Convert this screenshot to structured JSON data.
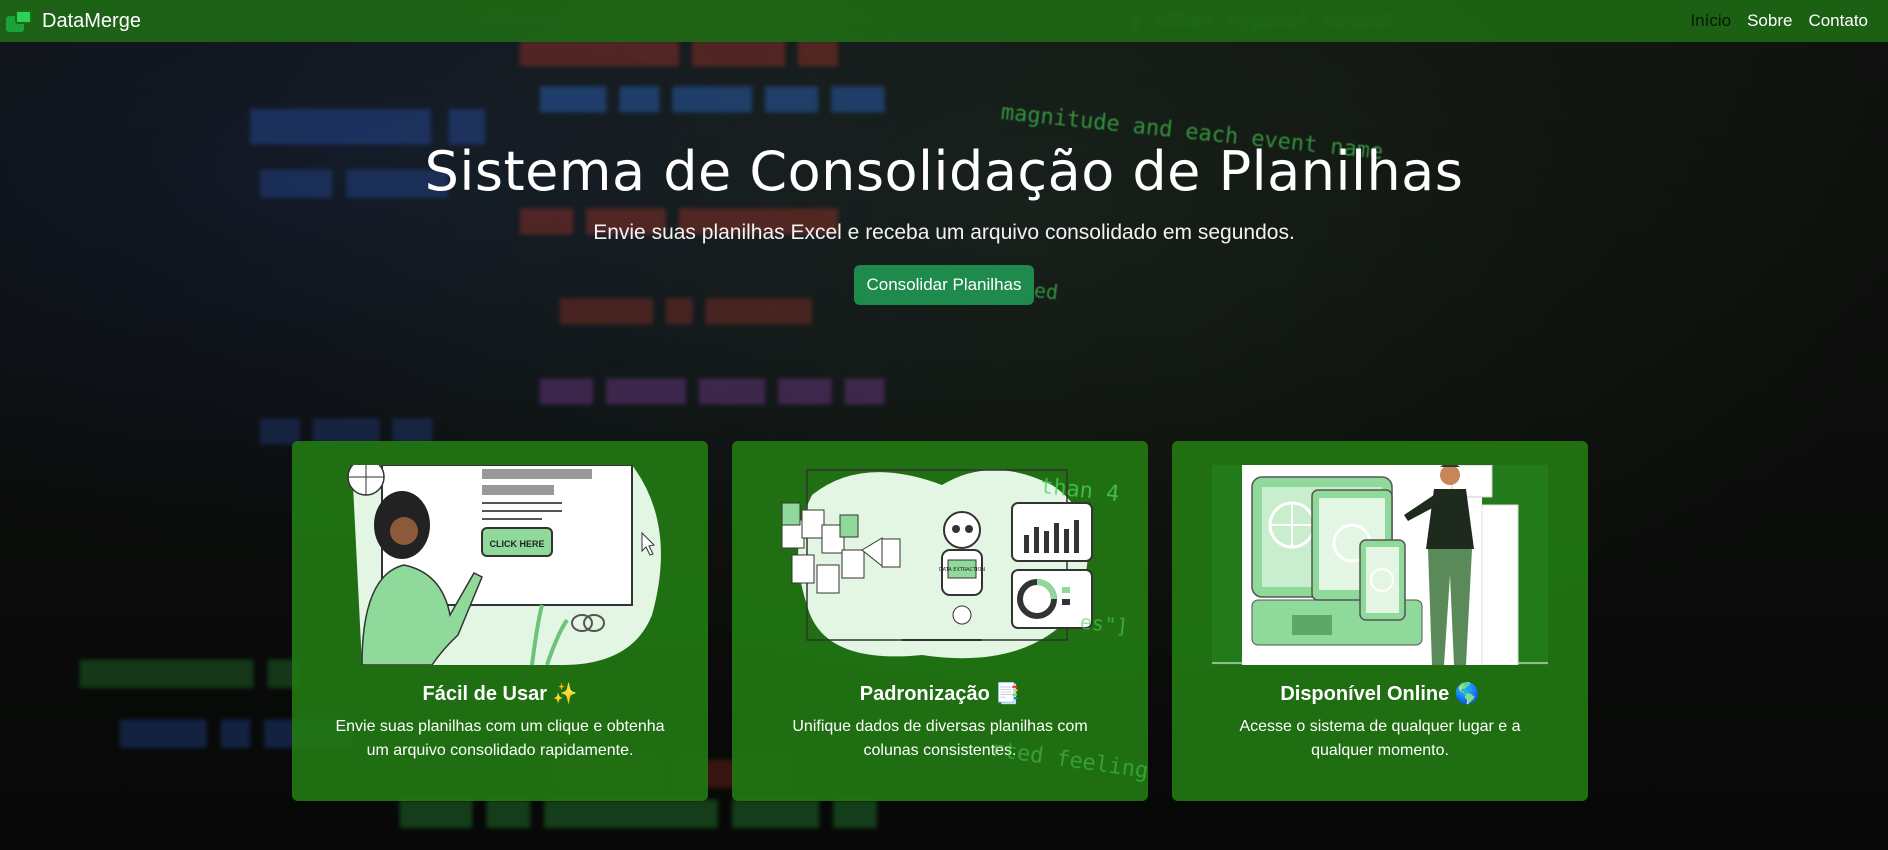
{
  "nav": {
    "brand": "DataMerge",
    "links": [
      "Início",
      "Sobre",
      "Contato"
    ]
  },
  "hero": {
    "title": "Sistema de Consolidação de Planilhas",
    "subtitle": "Envie suas planilhas Excel e receba um arquivo consolidado em segundos.",
    "cta": "Consolidar Planilhas"
  },
  "cards": [
    {
      "title": "Fácil de Usar ✨",
      "text": "Envie suas planilhas com um clique e obtenha um arquivo consolidado rapidamente.",
      "illustration_label": "CLICK HERE"
    },
    {
      "title": "Padronização 📑",
      "text": "Unifique dados de diversas planilhas com colunas consistentes.",
      "illustration_label": "DATA EXTRACTION"
    },
    {
      "title": "Disponível Online 🌎",
      "text": "Acesse o sistema de qualquer lugar e a qualquer momento."
    }
  ],
  "colors": {
    "navbar": "#1e6e14",
    "card": "#22781a",
    "cta": "#1e8a4c",
    "illustration_green": "#8fd99a"
  }
}
